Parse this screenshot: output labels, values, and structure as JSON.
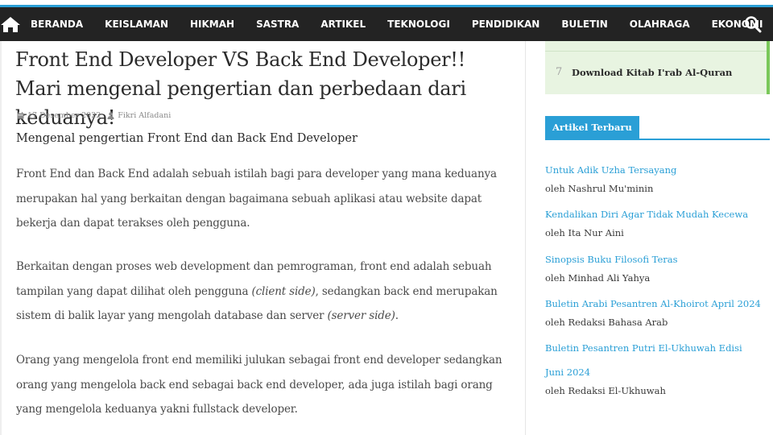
{
  "nav": {
    "items": [
      "BERANDA",
      "KEISLAMAN",
      "HIKMAH",
      "SASTRA",
      "ARTIKEL",
      "TEKNOLOGI",
      "PENDIDIKAN",
      "BULETIN",
      "OLAHRAGA",
      "EKONOMI"
    ],
    "home_icon": "home-icon",
    "search_icon": "search-icon"
  },
  "colors": {
    "nav_bg": "#232323",
    "accent": "#2a9fd6",
    "popular_bg": "#e8f4e1",
    "popular_border": "#7ac85a"
  },
  "article": {
    "title": "Front End Developer VS Back End Developer!! Mari mengenal pengertian dan perbedaan dari keduanya!",
    "date": "17 Desember 2022",
    "author": "Fikri Alfadani",
    "subtitle": "Mengenal pengertian Front End dan Back End Developer",
    "p1": "Front End dan Back End adalah sebuah istilah bagi para developer yang mana keduanya merupakan hal yang berkaitan dengan bagaimana sebuah aplikasi atau website dapat bekerja dan dapat terakses oleh pengguna.",
    "p2_a": "Berkaitan dengan proses web development dan pemrograman, front end adalah sebuah tampilan yang dapat dilihat oleh pengguna ",
    "p2_em1": "(client side)",
    "p2_b": ", sedangkan back end merupakan sistem di balik layar yang mengolah database dan server ",
    "p2_em2": "(server side)",
    "p2_c": ".",
    "p3": "Orang yang mengelola front end memiliki julukan sebagai front end developer sedangkan orang yang mengelola back end sebagai back end developer, ada juga istilah bagi orang yang mengelola keduanya yakni fullstack developer."
  },
  "sidebar": {
    "popular_item": {
      "number": "7",
      "title": "Download Kitab I'rab Al-Quran"
    },
    "recent_heading": "Artikel Terbaru",
    "recent": [
      {
        "title": "Untuk Adik Uzha Tersayang",
        "author": "oleh Nashrul Mu'minin"
      },
      {
        "title": "Kendalikan Diri Agar Tidak Mudah Kecewa",
        "author": "oleh Ita Nur Aini"
      },
      {
        "title": "Sinopsis Buku Filosofi Teras",
        "author": "oleh Minhad Ali Yahya"
      },
      {
        "title": "Buletin Arabi Pesantren Al-Khoirot April 2024",
        "author": "oleh Redaksi Bahasa Arab"
      },
      {
        "title": "Buletin Pesantren Putri El-Ukhuwah Edisi Juni 2024",
        "author": "oleh Redaksi El-Ukhuwah"
      }
    ]
  }
}
